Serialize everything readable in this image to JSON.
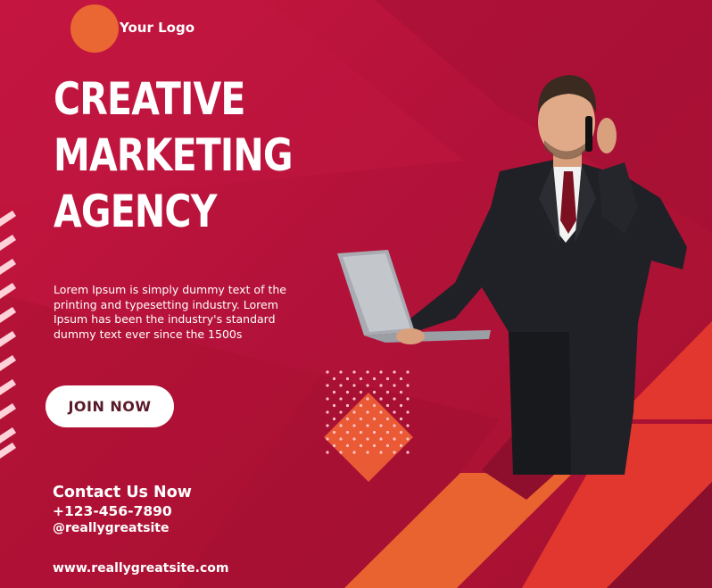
{
  "logo": {
    "text": "Your Logo"
  },
  "headline": {
    "line1": "CREATIVE",
    "line2": "MARKETING",
    "line3": "AGENCY"
  },
  "description": "Lorem Ipsum is simply dummy text of the printing and typesetting industry. Lorem Ipsum has been the industry's standard dummy text ever since the 1500s",
  "cta": {
    "label": "JOIN NOW"
  },
  "contact": {
    "title": "Contact Us Now",
    "phone": "+123-456-7890",
    "social": "@reallygreatsite",
    "website": "www.reallygreatsite.com"
  },
  "colors": {
    "background": "#b3123a",
    "accent_orange": "#ea6633",
    "accent_red": "#e23a34",
    "dark_maroon": "#8a0f2c",
    "button_bg": "#ffffff",
    "button_text": "#5a1a2a"
  }
}
